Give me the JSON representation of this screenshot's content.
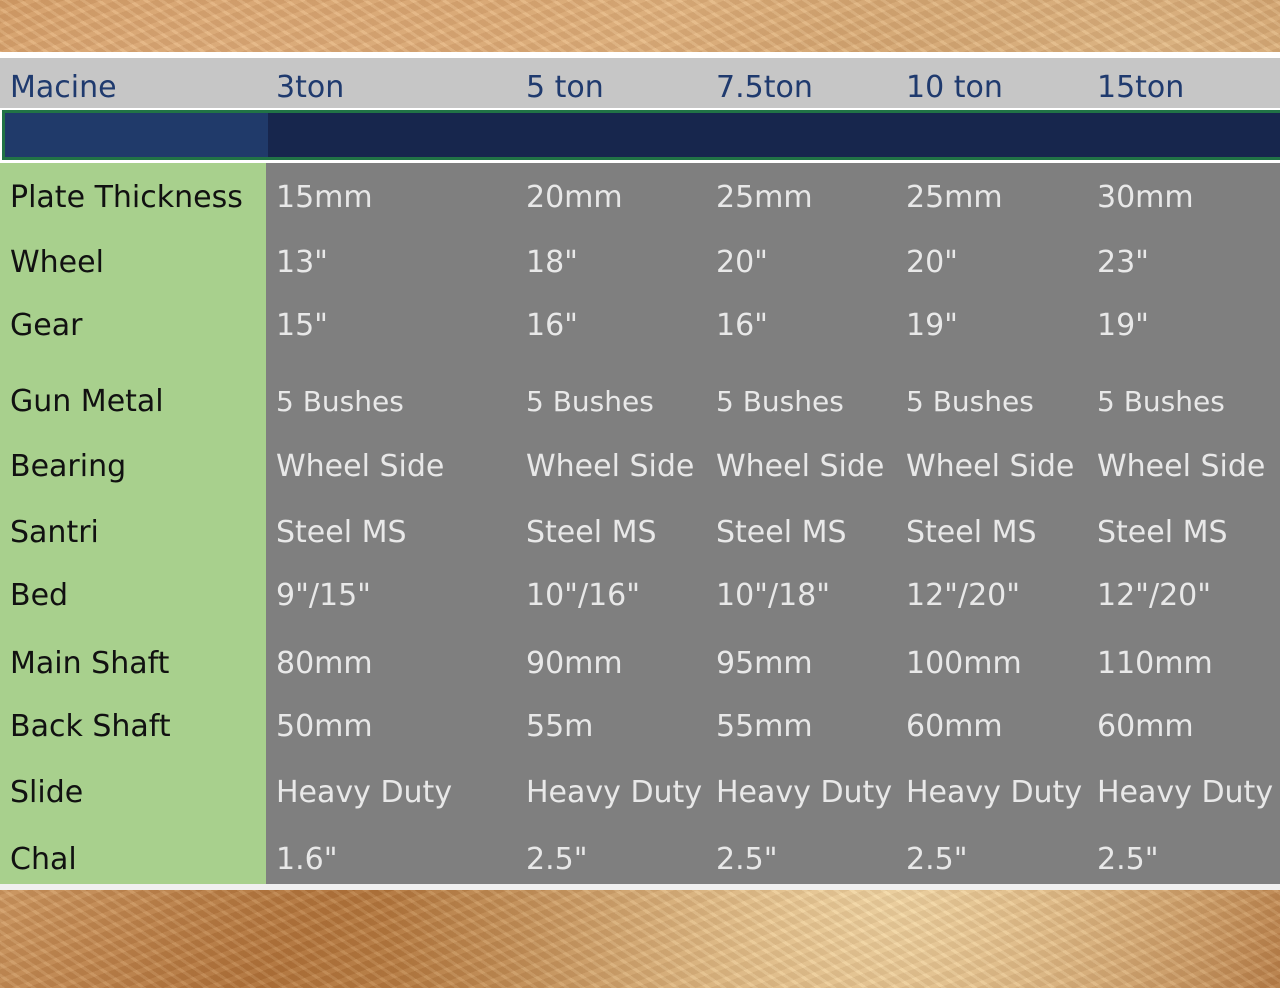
{
  "table": {
    "headers": [
      "Macine",
      "3ton",
      "5 ton",
      "7.5ton",
      "10 ton",
      "15ton"
    ],
    "rows": [
      {
        "label": "Plate Thickness",
        "values": [
          "15mm",
          "20mm",
          "25mm",
          "25mm",
          "30mm"
        ]
      },
      {
        "label": "Wheel",
        "values": [
          "13\"",
          "18\"",
          "20\"",
          "20\"",
          "23\""
        ]
      },
      {
        "label": "Gear",
        "values": [
          "15\"",
          "16\"",
          "16\"",
          "19\"",
          "19\""
        ]
      },
      {
        "label": "Gun Metal",
        "values": [
          "5 Bushes",
          "5 Bushes",
          "5 Bushes",
          "5 Bushes",
          "5 Bushes"
        ]
      },
      {
        "label": "Bearing",
        "values": [
          "Wheel Side",
          "Wheel Side",
          "Wheel Side",
          "Wheel Side",
          "Wheel Side"
        ]
      },
      {
        "label": "Santri",
        "values": [
          "Steel MS",
          "Steel MS",
          "Steel MS",
          "Steel MS",
          "Steel MS"
        ]
      },
      {
        "label": "Bed",
        "values": [
          "9\"/15\"",
          "10\"/16\"",
          "10\"/18\"",
          "12\"/20\"",
          "12\"/20\""
        ]
      },
      {
        "label": "Main Shaft",
        "values": [
          "80mm",
          "90mm",
          "95mm",
          "100mm",
          "110mm"
        ]
      },
      {
        "label": "Back Shaft",
        "values": [
          "50mm",
          "55m",
          "55mm",
          "60mm",
          "60mm"
        ]
      },
      {
        "label": "Slide",
        "values": [
          "Heavy Duty",
          "Heavy Duty",
          "Heavy Duty",
          "Heavy Duty",
          "Heavy Duty"
        ]
      },
      {
        "label": "Chal",
        "values": [
          "1.6\"",
          "2.5\"",
          "2.5\"",
          "2.5\"",
          "2.5\""
        ]
      }
    ]
  },
  "colors": {
    "header_text": "#1f3a6e",
    "label_column": "#a8d08d",
    "value_area": "#7f7f7f",
    "selected_row": "#17264d",
    "selection_border": "#217346"
  }
}
